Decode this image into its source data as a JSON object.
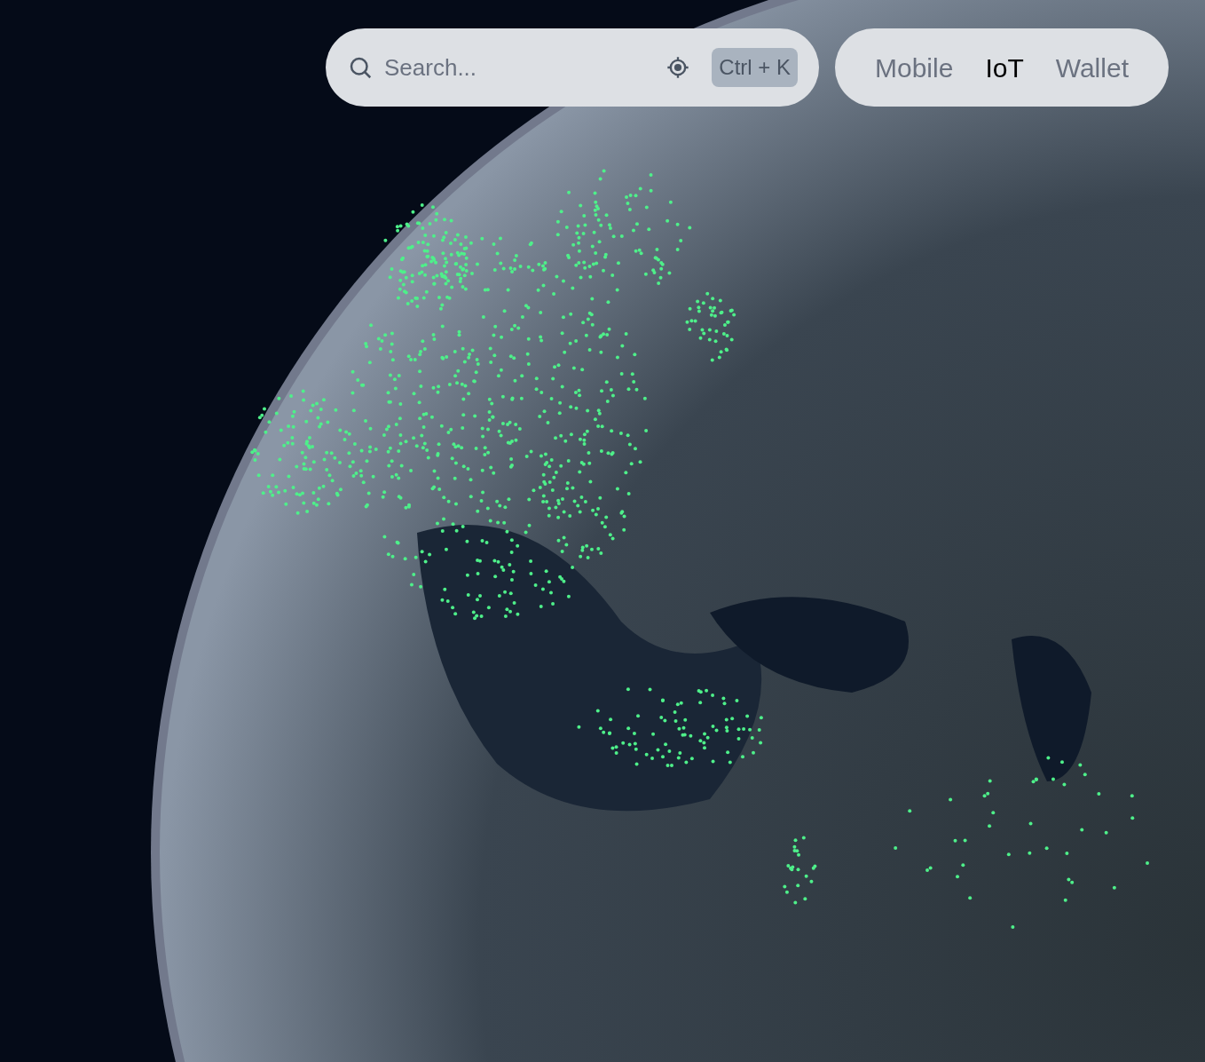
{
  "search": {
    "placeholder": "Search...",
    "shortcut": "Ctrl + K"
  },
  "tabs": [
    {
      "label": "Mobile",
      "selected": false
    },
    {
      "label": "IoT",
      "selected": true
    },
    {
      "label": "Wallet",
      "selected": false
    }
  ]
}
